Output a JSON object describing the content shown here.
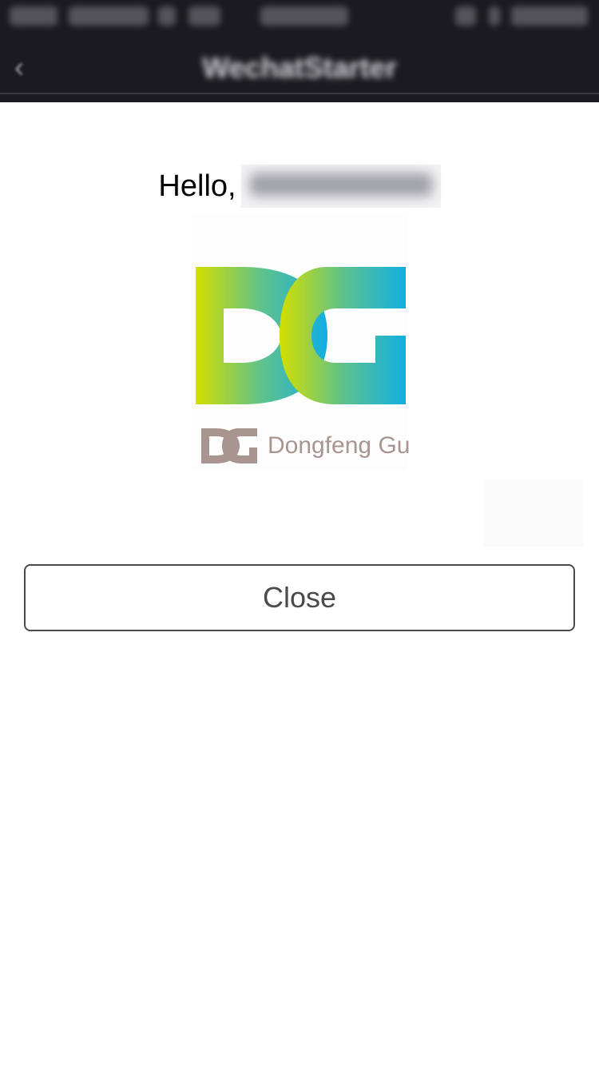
{
  "status_bar": {
    "carrier": "",
    "time": "",
    "battery": ""
  },
  "nav": {
    "back_label": "",
    "title": "WechatStarter",
    "action_label": ""
  },
  "greeting": {
    "hello_text": "Hello,"
  },
  "logo": {
    "caption": "Dongfeng Gu",
    "colors": {
      "gradient_start": "#d4de00",
      "gradient_mid": "#5fc28b",
      "gradient_end": "#12aee3",
      "mark_small": "#a8958f"
    }
  },
  "actions": {
    "close_label": "Close"
  }
}
